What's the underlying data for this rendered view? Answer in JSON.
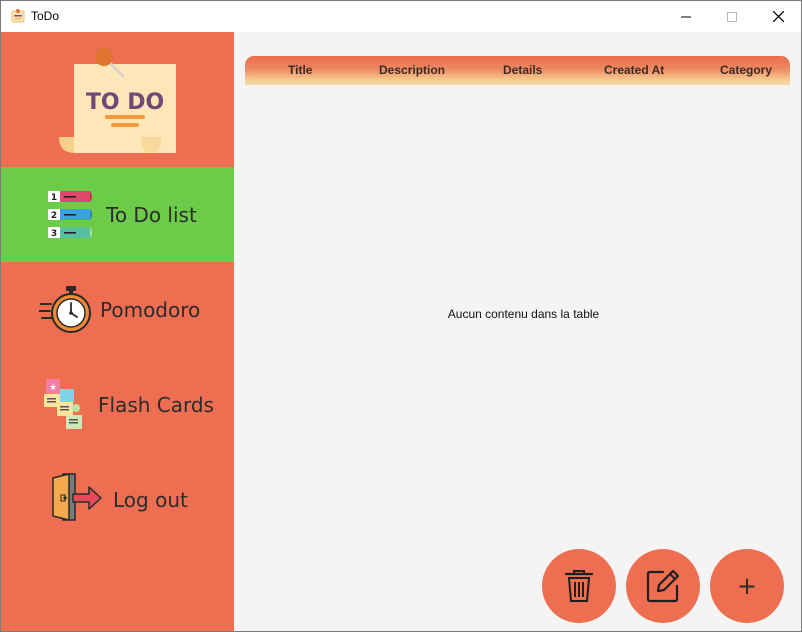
{
  "window": {
    "title": "ToDo",
    "icon": "todo-app-icon",
    "controls": [
      "minimize-icon",
      "maximize-icon",
      "close-icon"
    ]
  },
  "sidebar": {
    "logo_text": "TO DO",
    "items": [
      {
        "label": "To Do list",
        "icon": "numbered-list-icon",
        "active": true
      },
      {
        "label": "Pomodoro",
        "icon": "stopwatch-icon",
        "active": false
      },
      {
        "label": "Flash Cards",
        "icon": "flash-cards-icon",
        "active": false
      },
      {
        "label": "Log out",
        "icon": "exit-door-icon",
        "active": false
      }
    ]
  },
  "table": {
    "columns": [
      "Title",
      "Description",
      "Details",
      "Created At",
      "Category"
    ],
    "rows": [],
    "empty_message": "Aucun contenu dans la table"
  },
  "actions": {
    "delete_icon": "trash-icon",
    "edit_icon": "edit-icon",
    "add_label": "+"
  },
  "colors": {
    "sidebar": "#ee6e51",
    "active_item": "#6dcb4a",
    "content_bg": "#f4f4f4",
    "fab": "#ee6e51"
  }
}
